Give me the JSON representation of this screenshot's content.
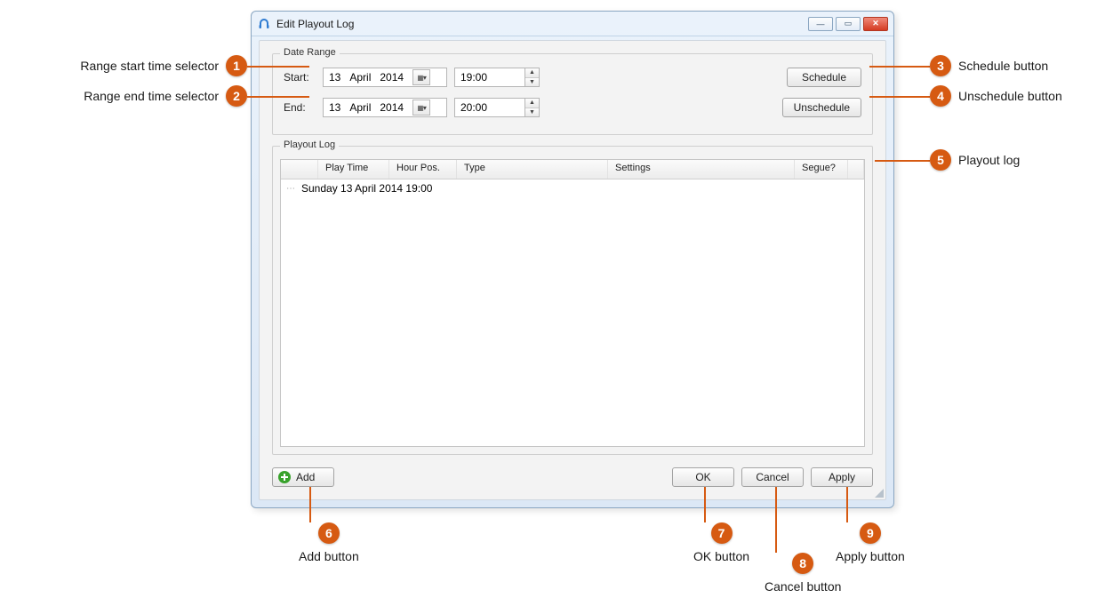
{
  "window": {
    "title": "Edit Playout Log"
  },
  "dateRange": {
    "legend": "Date Range",
    "startLabel": "Start:",
    "endLabel": "End:",
    "start": {
      "day": "13",
      "month": "April",
      "year": "2014",
      "time": "19:00"
    },
    "end": {
      "day": "13",
      "month": "April",
      "year": "2014",
      "time": "20:00"
    },
    "scheduleLabel": "Schedule",
    "unscheduleLabel": "Unschedule"
  },
  "playout": {
    "legend": "Playout Log",
    "columns": {
      "blank": "",
      "playTime": "Play Time",
      "hourPos": "Hour Pos.",
      "type": "Type",
      "settings": "Settings",
      "segue": "Segue?",
      "trailing": ""
    },
    "entries": [
      {
        "label": "Sunday 13 April 2014 19:00"
      }
    ]
  },
  "buttons": {
    "add": "Add",
    "ok": "OK",
    "cancel": "Cancel",
    "apply": "Apply"
  },
  "annotations": {
    "c1": {
      "num": "1",
      "text": "Range start time selector"
    },
    "c2": {
      "num": "2",
      "text": "Range end time selector"
    },
    "c3": {
      "num": "3",
      "text": "Schedule button"
    },
    "c4": {
      "num": "4",
      "text": "Unschedule button"
    },
    "c5": {
      "num": "5",
      "text": "Playout log"
    },
    "c6": {
      "num": "6",
      "text": "Add button"
    },
    "c7": {
      "num": "7",
      "text": "OK button"
    },
    "c8": {
      "num": "8",
      "text": "Cancel button"
    },
    "c9": {
      "num": "9",
      "text": "Apply button"
    }
  }
}
